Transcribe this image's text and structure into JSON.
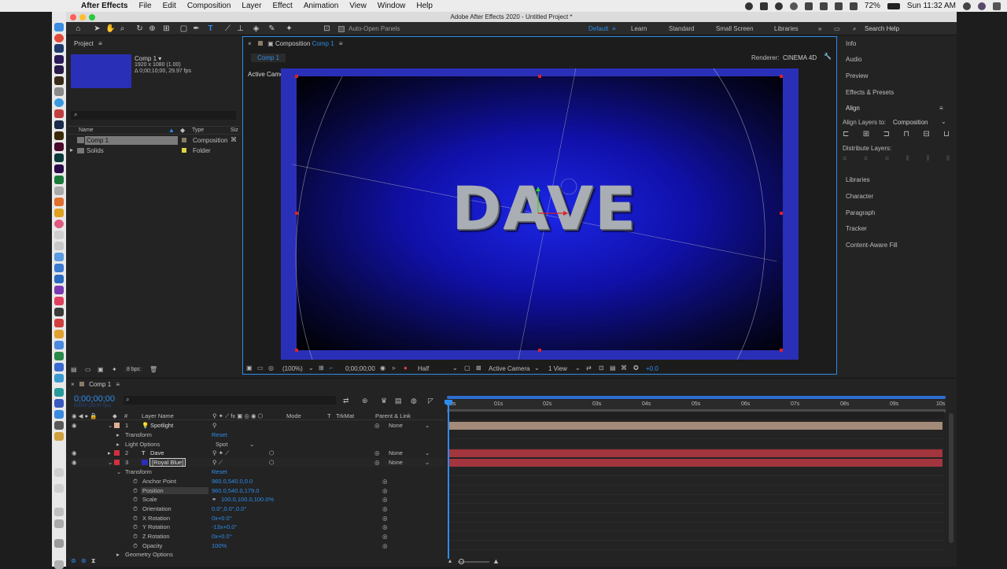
{
  "menubar": {
    "app_name": "After Effects",
    "items": [
      "File",
      "Edit",
      "Composition",
      "Layer",
      "Effect",
      "Animation",
      "View",
      "Window",
      "Help"
    ],
    "battery": "72%",
    "clock": "Sun 11:32 AM"
  },
  "window": {
    "title": "Adobe After Effects 2020 - Untitled Project *"
  },
  "toolbar": {
    "auto_open": "Auto-Open Panels",
    "workspaces": [
      "Default",
      "Learn",
      "Standard",
      "Small Screen",
      "Libraries"
    ],
    "search_help": "Search Help"
  },
  "project": {
    "tab_label": "Project",
    "comp_name": "Comp 1 ▾",
    "comp_info_1": "1920 x 1080 (1.00)",
    "comp_info_2": "Δ 0;00;10;00, 29.97 fps",
    "search_placeholder": "",
    "col_name": "Name",
    "col_type": "Type",
    "col_size": "Siz",
    "rows": [
      {
        "name": "Comp 1",
        "type": "Composition"
      },
      {
        "name": "Solids",
        "type": "Folder"
      }
    ],
    "bpc": "8 bpc"
  },
  "composition": {
    "tab_prefix": "Composition",
    "tab_comp": "Comp 1",
    "subtab": "Comp 1",
    "renderer_label": "Renderer:",
    "renderer_value": "CINEMA 4D",
    "camera_label": "Active Camera",
    "text": "DAVE",
    "zoom": "(100%)",
    "timecode": "0;00;00;00",
    "resolution": "Half",
    "camera_select": "Active Camera",
    "views": "1 View",
    "exposure": "+0.0"
  },
  "right_panel": {
    "items_top": [
      "Info",
      "Audio",
      "Preview",
      "Effects & Presets",
      "Align"
    ],
    "align_to_label": "Align Layers to:",
    "align_to_value": "Composition",
    "distribute_label": "Distribute Layers:",
    "items_bottom": [
      "Libraries",
      "Character",
      "Paragraph",
      "Tracker",
      "Content-Aware Fill"
    ]
  },
  "timeline": {
    "tab_label": "Comp 1",
    "timecode": "0;00;00;00",
    "frame_info": "00000 (29.97 fps)",
    "col_layer": "Layer Name",
    "col_mode": "Mode",
    "col_t": "T",
    "col_trkmat": "TrkMat",
    "col_parent": "Parent & Link",
    "ruler": [
      "0s",
      "01s",
      "02s",
      "03s",
      "04s",
      "05s",
      "06s",
      "07s",
      "08s",
      "09s",
      "10s"
    ],
    "layers": [
      {
        "num": "1",
        "name": "Spotlight",
        "parent": "None"
      },
      {
        "num": "2",
        "name": "Dave",
        "parent": "None"
      },
      {
        "num": "3",
        "name": "[Royal Blue]",
        "parent": "None"
      }
    ],
    "transform": "Transform",
    "reset": "Reset",
    "light_options": "Light Options",
    "light_type": "Spot",
    "props": [
      {
        "name": "Anchor Point",
        "value": "960.0,540.0,0.0"
      },
      {
        "name": "Position",
        "value": "960.0,540.0,179.0"
      },
      {
        "name": "Scale",
        "value": "100.0,100.0,100.0%"
      },
      {
        "name": "Orientation",
        "value": "0.0°,0.0°,0.0°"
      },
      {
        "name": "X Rotation",
        "value": "0x+0.0°"
      },
      {
        "name": "Y Rotation",
        "value": "-13x+0.0°"
      },
      {
        "name": "Z Rotation",
        "value": "0x+0.0°"
      },
      {
        "name": "Opacity",
        "value": "100%"
      }
    ],
    "geometry_options": "Geometry Options"
  },
  "colors": {
    "accent": "#2d8ceb",
    "comp_blue": "#2a2fb8",
    "spot_bar": "#a48a78",
    "layer_bar": "#a3353e"
  }
}
